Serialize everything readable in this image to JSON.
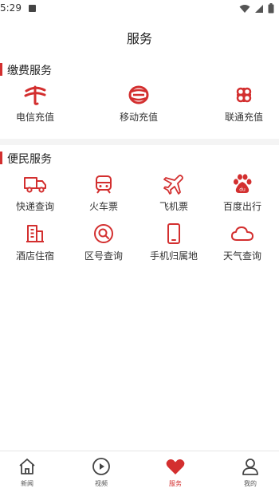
{
  "status": {
    "time": "5:29"
  },
  "page": {
    "title": "服务"
  },
  "colors": {
    "accent": "#d32f2f"
  },
  "payment": {
    "title": "缴费服务",
    "items": [
      {
        "label": "电信充值",
        "icon": "china-telecom-logo-icon"
      },
      {
        "label": "移动充值",
        "icon": "china-mobile-logo-icon"
      },
      {
        "label": "联通充值",
        "icon": "china-unicom-logo-icon"
      }
    ]
  },
  "convenience": {
    "title": "便民服务",
    "items": [
      {
        "label": "快递查询",
        "icon": "truck-icon"
      },
      {
        "label": "火车票",
        "icon": "train-icon"
      },
      {
        "label": "飞机票",
        "icon": "airplane-icon"
      },
      {
        "label": "百度出行",
        "icon": "baidu-paw-icon"
      },
      {
        "label": "酒店住宿",
        "icon": "hotel-icon"
      },
      {
        "label": "区号查询",
        "icon": "search-icon"
      },
      {
        "label": "手机归属地",
        "icon": "phone-icon"
      },
      {
        "label": "天气查询",
        "icon": "cloud-icon"
      }
    ]
  },
  "tabbar": {
    "items": [
      {
        "label": "新闻",
        "icon": "home-icon",
        "active": false
      },
      {
        "label": "视频",
        "icon": "play-icon",
        "active": false
      },
      {
        "label": "服务",
        "icon": "heart-icon",
        "active": true
      },
      {
        "label": "我的",
        "icon": "person-icon",
        "active": false
      }
    ]
  }
}
